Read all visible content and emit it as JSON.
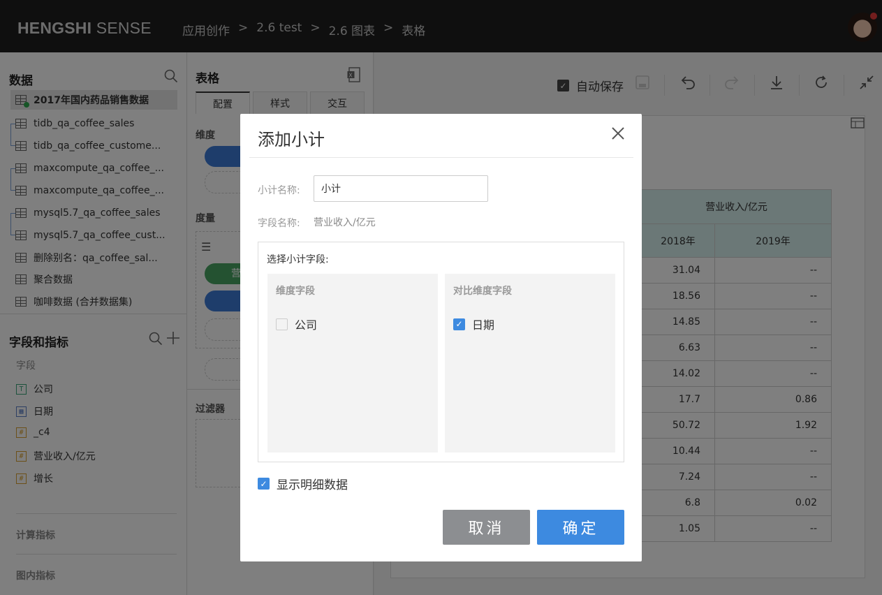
{
  "header": {
    "logo_bold": "HENGSHI",
    "logo_light": " SENSE",
    "breadcrumbs": [
      "应用创作",
      "2.6 test",
      "2.6 图表",
      "表格"
    ],
    "separator": ">"
  },
  "data_panel": {
    "title": "数据",
    "datasets": [
      "2017年国内药品销售数据",
      "tidb_qa_coffee_sales",
      "tidb_qa_coffee_custome...",
      "maxcompute_qa_coffee_...",
      "maxcompute_qa_coffee_...",
      "mysql5.7_qa_coffee_sales",
      "mysql5.7_qa_coffee_cust...",
      "删除别名：qa_coffee_sal...",
      "聚合数据",
      "咖啡数据 (合并数据集)"
    ]
  },
  "fields_panel": {
    "title": "字段和指标",
    "section": "字段",
    "fields": [
      {
        "tag": "T",
        "name": "公司"
      },
      {
        "tag": "",
        "name": "日期"
      },
      {
        "tag": "#",
        "name": "_c4"
      },
      {
        "tag": "#",
        "name": "营业收入/亿元"
      },
      {
        "tag": "#",
        "name": "增长"
      }
    ],
    "calc_metrics": "计算指标",
    "chart_metrics": "图内指标"
  },
  "config_panel": {
    "title": "表格",
    "tabs": [
      "配置",
      "样式",
      "交互"
    ],
    "dimension": "维度",
    "measure": "度量",
    "measure_pill": "营",
    "filter": "过滤器"
  },
  "toolbar": {
    "autosave": "自动保存"
  },
  "table": {
    "header_top": "营业收入/亿元",
    "columns": [
      "2018年",
      "2019年"
    ],
    "rows": [
      [
        "31.04",
        "--"
      ],
      [
        "18.56",
        "--"
      ],
      [
        "14.85",
        "--"
      ],
      [
        "6.63",
        "--"
      ],
      [
        "14.02",
        "--"
      ],
      [
        "17.7",
        "0.86"
      ],
      [
        "50.72",
        "1.92"
      ],
      [
        "10.44",
        "--"
      ],
      [
        "7.24",
        "--"
      ],
      [
        "6.8",
        "0.02"
      ],
      [
        "1.05",
        "--"
      ]
    ]
  },
  "modal": {
    "title": "添加小计",
    "close": "X",
    "name_label": "小计名称:",
    "name_value": "小计",
    "field_label": "字段名称:",
    "field_value": "营业收入/亿元",
    "select_title": "选择小计字段:",
    "dim_header": "维度字段",
    "dim_option": "公司",
    "cmp_header": "对比维度字段",
    "cmp_option": "日期",
    "show_detail": "显示明细数据",
    "cancel": "取消",
    "ok": "确定"
  },
  "colors": {
    "primary": "#3d8ae0",
    "cancel": "#8c8e91",
    "table_header": "#d7f0ef",
    "topbar": "#1f1f1f"
  }
}
